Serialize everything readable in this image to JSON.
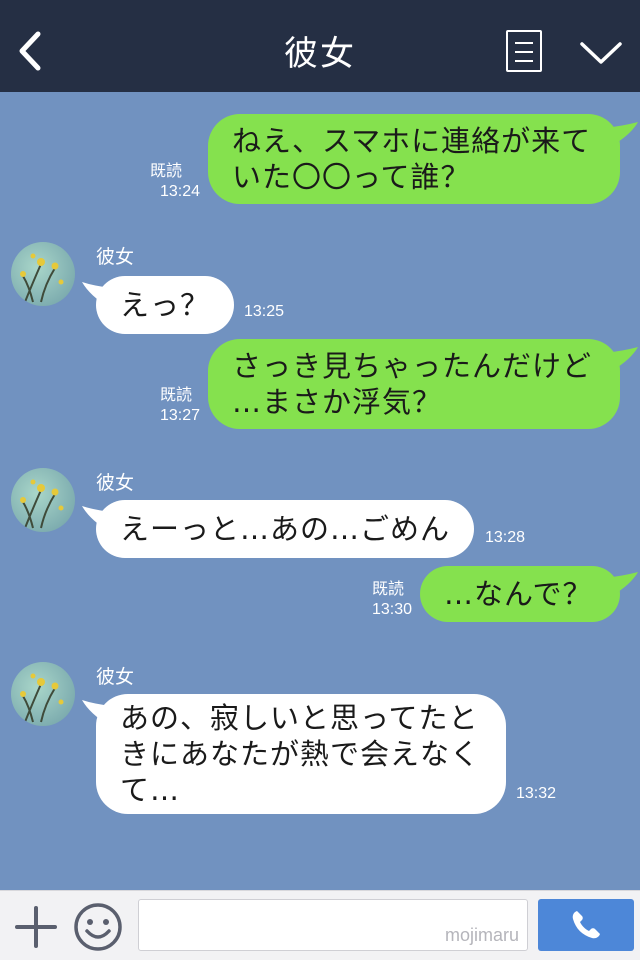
{
  "header": {
    "title": "彼女",
    "icons": [
      "back-icon",
      "menu-icon",
      "chevron-down-icon"
    ]
  },
  "colors": {
    "header_bg": "#252f44",
    "chat_bg": "#7192c0",
    "my_bubble": "#85e14e",
    "their_bubble": "#ffffff",
    "call_button": "#4d87d8"
  },
  "messages": [
    {
      "from": "me",
      "lines": [
        "ねえ、スマホに連絡が来て",
        "いた〇〇って誰？"
      ],
      "read": "既読",
      "time": "13:24"
    },
    {
      "from": "them",
      "sender": "彼女",
      "lines": [
        "えっ？"
      ],
      "time": "13:25"
    },
    {
      "from": "me",
      "lines": [
        "さっき見ちゃったんだけど",
        "…まさか浮気？"
      ],
      "read": "既読",
      "time": "13:27"
    },
    {
      "from": "them",
      "sender": "彼女",
      "lines": [
        "えーっと…あの…ごめん"
      ],
      "time": "13:28"
    },
    {
      "from": "me",
      "lines": [
        "…なんで？"
      ],
      "read": "既読",
      "time": "13:30"
    },
    {
      "from": "them",
      "sender": "彼女",
      "lines": [
        "あの、寂しいと思ってたと",
        "きにあなたが熱で会えなく",
        "て…"
      ],
      "time": "13:32"
    }
  ],
  "footer": {
    "input_value": "",
    "watermark": "mojimaru",
    "icons": [
      "plus-icon",
      "smile-icon",
      "phone-icon"
    ]
  }
}
